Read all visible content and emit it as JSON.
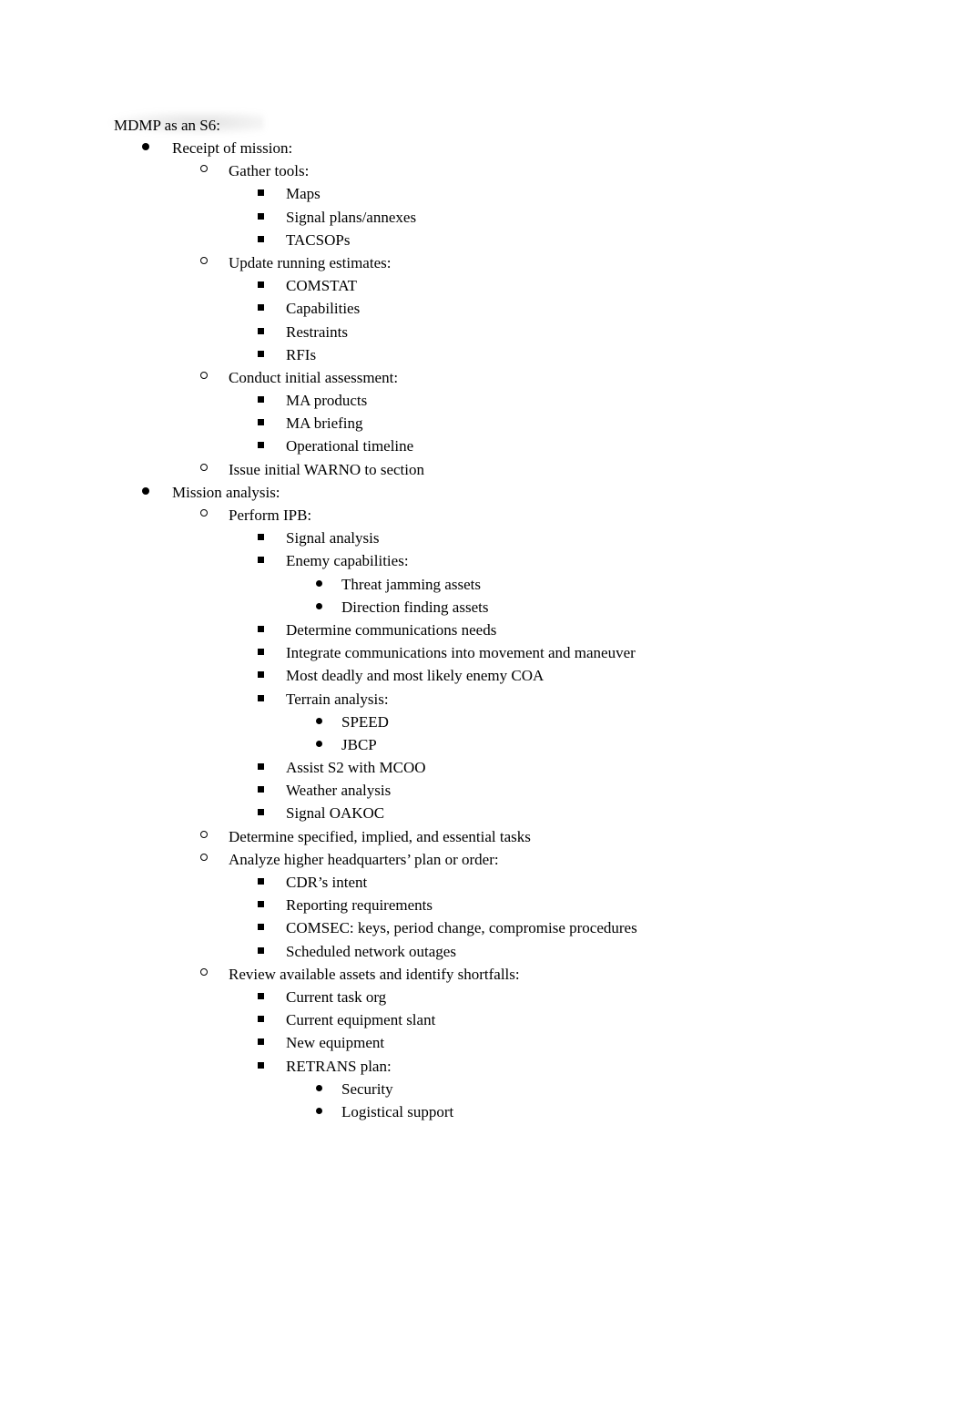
{
  "document": {
    "title": "MDMP as an S6:",
    "outline": [
      {
        "level": 1,
        "bullet": "disc",
        "text": "Receipt of mission:"
      },
      {
        "level": 2,
        "bullet": "circle",
        "text": "Gather tools:"
      },
      {
        "level": 3,
        "bullet": "square",
        "text": "Maps"
      },
      {
        "level": 3,
        "bullet": "square",
        "text": "Signal plans/annexes"
      },
      {
        "level": 3,
        "bullet": "square",
        "text": "TACSOPs"
      },
      {
        "level": 2,
        "bullet": "circle",
        "text": "Update running estimates:"
      },
      {
        "level": 3,
        "bullet": "square",
        "text": "COMSTAT"
      },
      {
        "level": 3,
        "bullet": "square",
        "text": "Capabilities"
      },
      {
        "level": 3,
        "bullet": "square",
        "text": "Restraints"
      },
      {
        "level": 3,
        "bullet": "square",
        "text": "RFIs"
      },
      {
        "level": 2,
        "bullet": "circle",
        "text": "Conduct initial assessment:"
      },
      {
        "level": 3,
        "bullet": "square",
        "text": "MA products"
      },
      {
        "level": 3,
        "bullet": "square",
        "text": "MA briefing"
      },
      {
        "level": 3,
        "bullet": "square",
        "text": "Operational timeline"
      },
      {
        "level": 2,
        "bullet": "circle",
        "text": "Issue initial WARNO to section"
      },
      {
        "level": 1,
        "bullet": "disc",
        "text": "Mission analysis:"
      },
      {
        "level": 2,
        "bullet": "circle",
        "text": "Perform IPB:"
      },
      {
        "level": 3,
        "bullet": "square",
        "text": "Signal analysis"
      },
      {
        "level": 3,
        "bullet": "square",
        "text": "Enemy capabilities:"
      },
      {
        "level": 4,
        "bullet": "disc-sm",
        "text": "Threat jamming assets"
      },
      {
        "level": 4,
        "bullet": "disc-sm",
        "text": "Direction finding assets"
      },
      {
        "level": 3,
        "bullet": "square",
        "text": "Determine communications needs"
      },
      {
        "level": 3,
        "bullet": "square",
        "text": "Integrate communications into movement and maneuver"
      },
      {
        "level": 3,
        "bullet": "square",
        "text": "Most deadly and most likely enemy COA"
      },
      {
        "level": 3,
        "bullet": "square",
        "text": "Terrain analysis:"
      },
      {
        "level": 4,
        "bullet": "disc-sm",
        "text": "SPEED"
      },
      {
        "level": 4,
        "bullet": "disc-sm",
        "text": "JBCP"
      },
      {
        "level": 3,
        "bullet": "square",
        "text": "Assist S2 with MCOO"
      },
      {
        "level": 3,
        "bullet": "square",
        "text": "Weather analysis"
      },
      {
        "level": 3,
        "bullet": "square",
        "text": "Signal OAKOC"
      },
      {
        "level": 2,
        "bullet": "circle",
        "text": "Determine specified, implied, and essential tasks"
      },
      {
        "level": 2,
        "bullet": "circle",
        "text": "Analyze higher headquarters’ plan or order:"
      },
      {
        "level": 3,
        "bullet": "square",
        "text": "CDR’s intent"
      },
      {
        "level": 3,
        "bullet": "square",
        "text": "Reporting requirements"
      },
      {
        "level": 3,
        "bullet": "square",
        "text": "COMSEC: keys, period change, compromise procedures"
      },
      {
        "level": 3,
        "bullet": "square",
        "text": "Scheduled network outages"
      },
      {
        "level": 2,
        "bullet": "circle",
        "text": "Review available assets and identify shortfalls:"
      },
      {
        "level": 3,
        "bullet": "square",
        "text": "Current task org"
      },
      {
        "level": 3,
        "bullet": "square",
        "text": "Current equipment slant"
      },
      {
        "level": 3,
        "bullet": "square",
        "text": "New equipment"
      },
      {
        "level": 3,
        "bullet": "square",
        "text": "RETRANS plan:"
      },
      {
        "level": 4,
        "bullet": "disc-sm",
        "text": "Security"
      },
      {
        "level": 4,
        "bullet": "disc-sm",
        "text": "Logistical support"
      }
    ]
  }
}
